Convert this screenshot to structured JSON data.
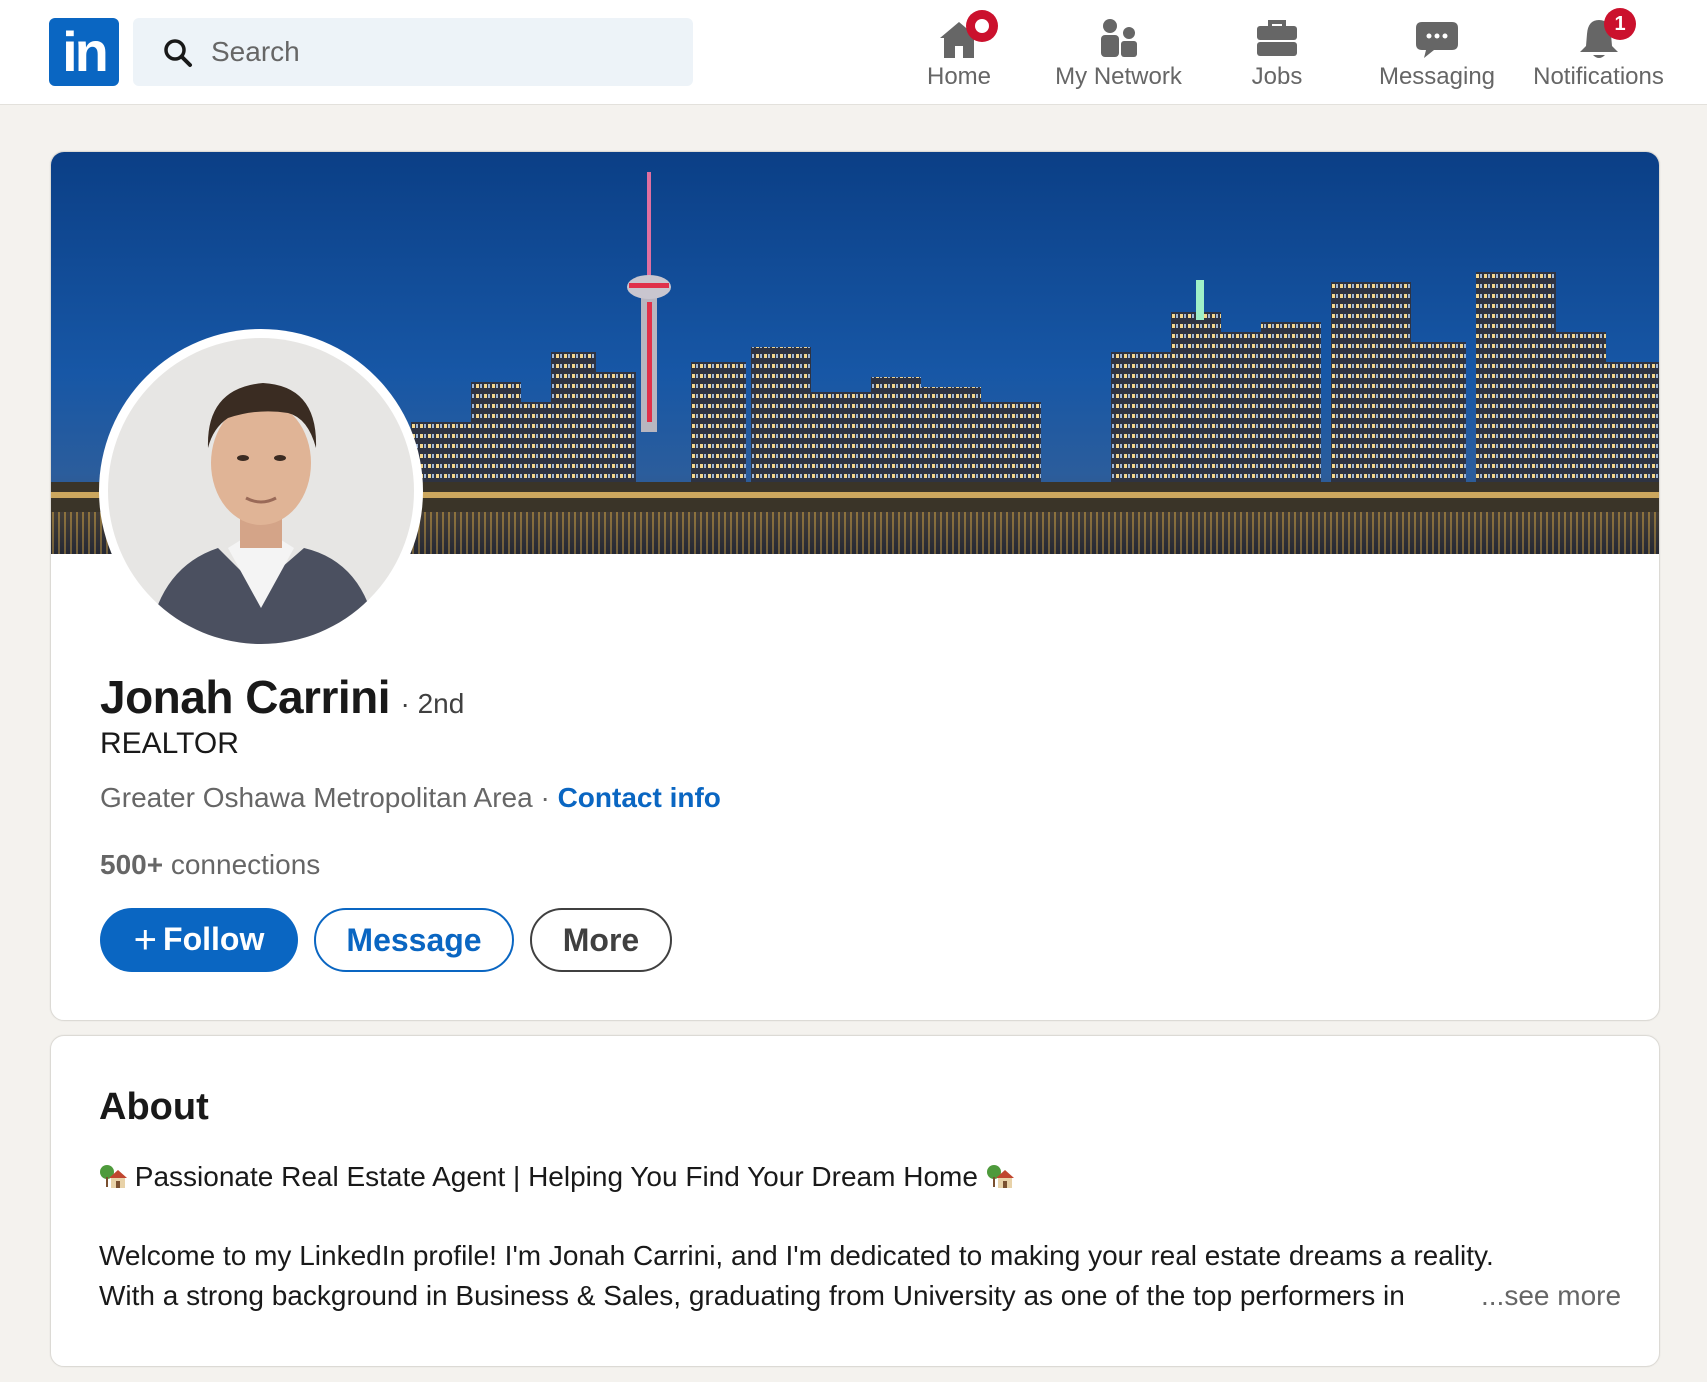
{
  "nav": {
    "logo": "in",
    "search_placeholder": "Search",
    "items": [
      {
        "label": "Home",
        "icon": "home-icon"
      },
      {
        "label": "My Network",
        "icon": "people-icon"
      },
      {
        "label": "Jobs",
        "icon": "briefcase-icon"
      },
      {
        "label": "Messaging",
        "icon": "chat-icon"
      },
      {
        "label": "Notifications",
        "icon": "bell-icon",
        "badge": "1"
      }
    ]
  },
  "profile": {
    "name": "Jonah Carrini",
    "degree": "· 2nd",
    "headline": "REALTOR",
    "location": "Greater Oshawa Metropolitan Area",
    "separator": " · ",
    "contact_label": "Contact info",
    "connections_count": "500+",
    "connections_label": " connections",
    "actions": {
      "follow": "Follow",
      "message": "Message",
      "more": "More"
    }
  },
  "about": {
    "title": "About",
    "tagline": "Passionate Real Estate Agent | Helping You Find Your Dream Home",
    "paragraph1": "Welcome to my LinkedIn profile! I'm Jonah Carrini, and I'm dedicated to making your real estate dreams a reality.",
    "paragraph2": "With a strong background in Business & Sales, graduating from University as one of the top performers in",
    "see_more": "...see more"
  },
  "colors": {
    "brand": "#0a66c2",
    "badge": "#cb112d",
    "background": "#f4f2ee"
  }
}
